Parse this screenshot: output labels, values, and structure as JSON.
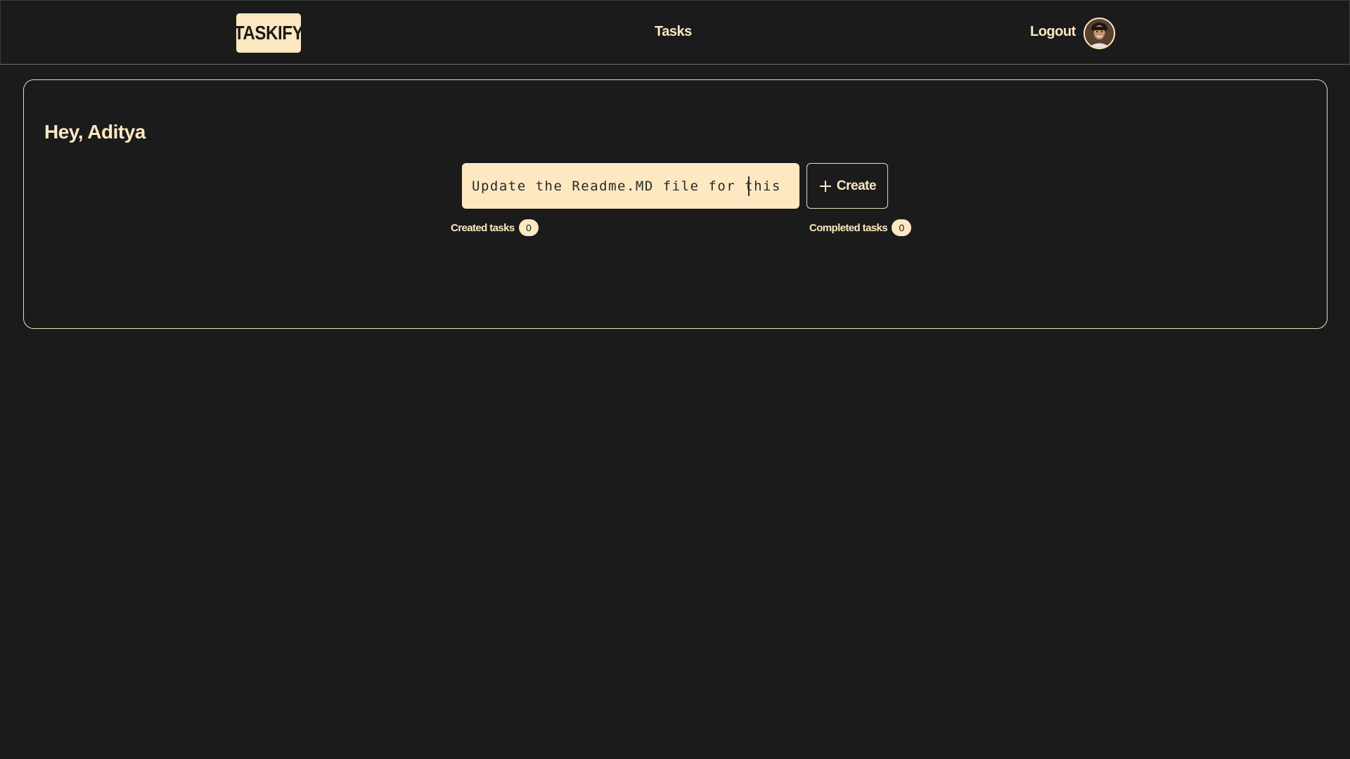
{
  "nav": {
    "logo": "TASKIFY",
    "tasks_link": "Tasks",
    "logout_link": "Logout",
    "avatar_icon": "user-avatar-icon"
  },
  "main": {
    "greeting": "Hey, Aditya",
    "task_input": {
      "value": "Update the Readme.MD file for this project",
      "placeholder": ""
    },
    "create_button": {
      "label": "Create",
      "icon": "plus-icon"
    },
    "stats": {
      "created_label": "Created tasks",
      "created_count": "0",
      "completed_label": "Completed tasks",
      "completed_count": "0"
    }
  },
  "colors": {
    "background": "#1b1b1b",
    "accent": "#fde8c2",
    "border": "#e8dcc0"
  }
}
